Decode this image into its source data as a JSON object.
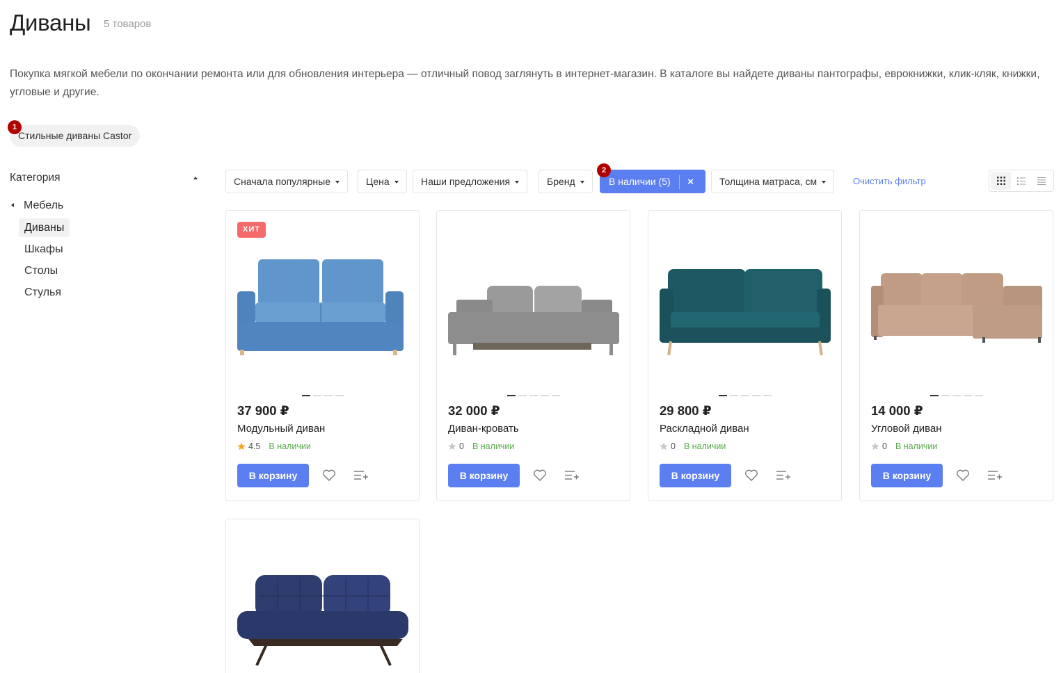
{
  "header": {
    "title": "Диваны",
    "count": "5 товаров"
  },
  "description": "Покупка мягкой мебели по окончании ремонта или для обновления интерьера — отличный повод заглянуть в интернет-магазин. В каталоге вы найдете диваны пантографы, еврокнижки, клик-кляк, книжки, угловые и другие.",
  "tags": [
    {
      "label": "Стильные диваны Castor",
      "marker": "1"
    }
  ],
  "sidebar": {
    "title": "Категория",
    "root": "Мебель",
    "items": [
      {
        "label": "Диваны",
        "active": true
      },
      {
        "label": "Шкафы",
        "active": false
      },
      {
        "label": "Столы",
        "active": false
      },
      {
        "label": "Стулья",
        "active": false
      }
    ]
  },
  "filters": {
    "sort": "Сначала популярные",
    "price": "Цена",
    "offers": "Наши предложения",
    "brand": "Бренд",
    "stock": "В наличии (5)",
    "stock_marker": "2",
    "stock_clear": "×",
    "mattress": "Толщина матраса, см",
    "clear": "Очистить фильтр"
  },
  "view_modes": [
    "grid-icon",
    "list-icon",
    "table-icon"
  ],
  "colors": {
    "accent": "#5b7ef0",
    "hit": "#f56b6b",
    "in_stock": "#56a847",
    "rating_star": "#f5a623"
  },
  "products": [
    {
      "badge": "ХИТ",
      "price": "37 900 ₽",
      "name": "Модульный диван",
      "rating": "4.5",
      "stock": "В наличии",
      "cart": "В корзину",
      "sofa_color": "#5b8fc4",
      "images": 4
    },
    {
      "badge": "",
      "price": "32 000 ₽",
      "name": "Диван-кровать",
      "rating": "0",
      "stock": "В наличии",
      "cart": "В корзину",
      "sofa_color": "#8f8f8f",
      "images": 5
    },
    {
      "badge": "",
      "price": "29 800 ₽",
      "name": "Раскладной диван",
      "rating": "0",
      "stock": "В наличии",
      "cart": "В корзину",
      "sofa_color": "#1f5a63",
      "images": 5
    },
    {
      "badge": "",
      "price": "14 000 ₽",
      "name": "Угловой диван",
      "rating": "0",
      "stock": "В наличии",
      "cart": "В корзину",
      "sofa_color": "#c9a48c",
      "images": 5
    },
    {
      "badge": "",
      "price": "",
      "name": "",
      "rating": "",
      "stock": "",
      "cart": "",
      "sofa_color": "#2c3a6a",
      "images": 0
    }
  ]
}
